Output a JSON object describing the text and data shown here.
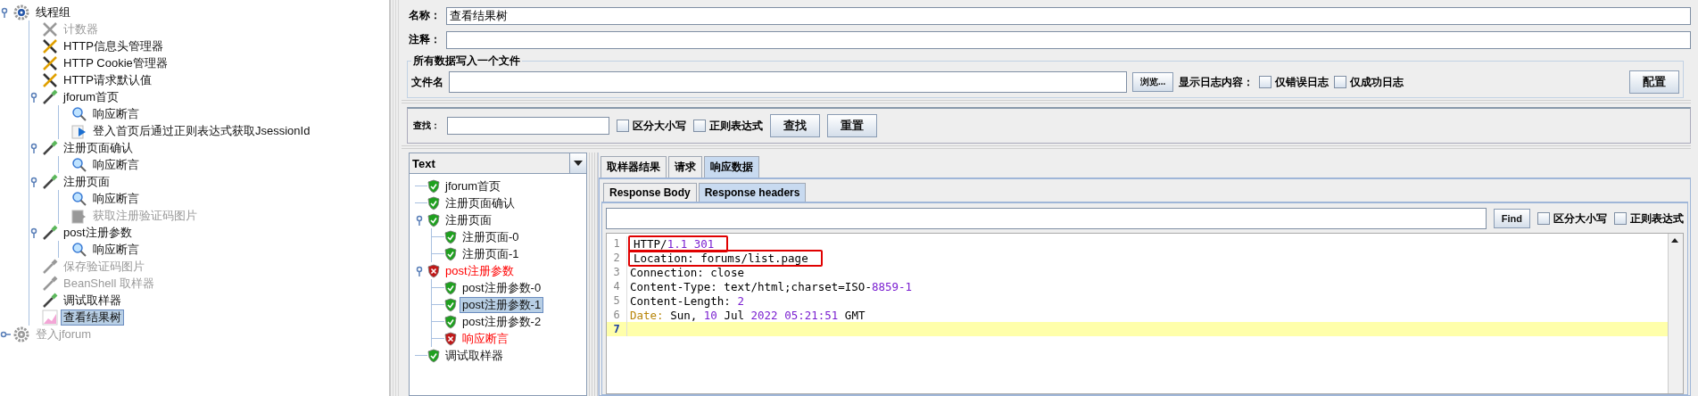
{
  "test_plan_tree": [
    {
      "label": "线程组",
      "kind": "thread_group",
      "disabled": false,
      "selected": false,
      "expanded": true,
      "children": [
        {
          "label": "计数器",
          "kind": "config",
          "disabled": true,
          "selected": false
        },
        {
          "label": "HTTP信息头管理器",
          "kind": "config",
          "disabled": false,
          "selected": false
        },
        {
          "label": "HTTP Cookie管理器",
          "kind": "config",
          "disabled": false,
          "selected": false
        },
        {
          "label": "HTTP请求默认值",
          "kind": "config",
          "disabled": false,
          "selected": false
        },
        {
          "label": "jforum首页",
          "kind": "sampler",
          "disabled": false,
          "selected": false,
          "expanded": true,
          "children": [
            {
              "label": "响应断言",
              "kind": "assertion",
              "disabled": false,
              "selected": false
            },
            {
              "label": "登入首页后通过正则表达式获取JsessionId",
              "kind": "extractor",
              "disabled": false,
              "selected": false
            }
          ]
        },
        {
          "label": "注册页面确认",
          "kind": "sampler",
          "disabled": false,
          "selected": false,
          "expanded": true,
          "children": [
            {
              "label": "响应断言",
              "kind": "assertion",
              "disabled": false,
              "selected": false
            }
          ]
        },
        {
          "label": "注册页面",
          "kind": "sampler",
          "disabled": false,
          "selected": false,
          "expanded": true,
          "children": [
            {
              "label": "响应断言",
              "kind": "assertion",
              "disabled": false,
              "selected": false
            },
            {
              "label": "获取注册验证码图片",
              "kind": "extractor",
              "disabled": true,
              "selected": false
            }
          ]
        },
        {
          "label": "post注册参数",
          "kind": "sampler",
          "disabled": false,
          "selected": false,
          "expanded": true,
          "children": [
            {
              "label": "响应断言",
              "kind": "assertion",
              "disabled": false,
              "selected": false
            }
          ]
        },
        {
          "label": "保存验证码图片",
          "kind": "sampler",
          "disabled": true,
          "selected": false
        },
        {
          "label": "BeanShell 取样器",
          "kind": "sampler",
          "disabled": true,
          "selected": false
        },
        {
          "label": "调试取样器",
          "kind": "sampler",
          "disabled": false,
          "selected": false
        },
        {
          "label": "查看结果树",
          "kind": "listener",
          "disabled": false,
          "selected": true
        }
      ]
    },
    {
      "label": "登入jforum",
      "kind": "thread_group",
      "disabled": true,
      "selected": false,
      "expanded": false
    }
  ],
  "form": {
    "name_label": "名称：",
    "name_value": "查看结果树",
    "comment_label": "注释：",
    "file_group": {
      "title": "所有数据写入一个文件",
      "file_label": "文件名",
      "browse_button": "浏览...",
      "log_label": "显示日志内容：",
      "checkboxes": [
        {
          "label": "仅错误日志",
          "checked": false
        },
        {
          "label": "仅成功日志",
          "checked": false
        }
      ],
      "config_button": "配置"
    }
  },
  "search_bar": {
    "label": "查找：",
    "checkboxes": [
      {
        "label": "区分大小写",
        "checked": false
      },
      {
        "label": "正则表达式",
        "checked": false
      }
    ],
    "find_button": "查找",
    "reset_button": "重置"
  },
  "renderer": {
    "value": "Text"
  },
  "results": [
    {
      "label": "jforum首页",
      "passed": true,
      "selected": false
    },
    {
      "label": "注册页面确认",
      "passed": true,
      "selected": false
    },
    {
      "label": "注册页面",
      "passed": true,
      "selected": false,
      "expanded": true,
      "children": [
        {
          "label": "注册页面-0",
          "passed": true,
          "selected": false
        },
        {
          "label": "注册页面-1",
          "passed": true,
          "selected": false
        }
      ]
    },
    {
      "label": "post注册参数",
      "passed": false,
      "selected": false,
      "expanded": true,
      "children": [
        {
          "label": "post注册参数-0",
          "passed": true,
          "selected": false
        },
        {
          "label": "post注册参数-1",
          "passed": true,
          "selected": true
        },
        {
          "label": "post注册参数-2",
          "passed": true,
          "selected": false
        },
        {
          "label": "响应断言",
          "passed": false,
          "selected": false
        }
      ]
    },
    {
      "label": "调试取样器",
      "passed": true,
      "selected": false
    }
  ],
  "tabs": [
    {
      "label": "取样器结果",
      "selected": false
    },
    {
      "label": "请求",
      "selected": false
    },
    {
      "label": "响应数据",
      "selected": true
    }
  ],
  "subtabs": [
    {
      "label": "Response Body",
      "selected": false
    },
    {
      "label": "Response headers",
      "selected": true
    }
  ],
  "find_bar": {
    "button": "Find",
    "checkboxes": [
      {
        "label": "区分大小写",
        "checked": false
      },
      {
        "label": "正则表达式",
        "checked": false
      }
    ]
  },
  "code_lines": [
    {
      "number": "1",
      "boxed": true,
      "current": false,
      "tokens": [
        {
          "text": "HTTP/",
          "kind": "plain"
        },
        {
          "text": "1.1 301",
          "kind": "number"
        }
      ]
    },
    {
      "number": "2",
      "boxed": true,
      "current": false,
      "tokens": [
        {
          "text": "Location: forums/list.page",
          "kind": "plain"
        }
      ]
    },
    {
      "number": "3",
      "boxed": false,
      "current": false,
      "tokens": [
        {
          "text": "Connection: close",
          "kind": "plain"
        }
      ]
    },
    {
      "number": "4",
      "boxed": false,
      "current": false,
      "tokens": [
        {
          "text": "Content-Type: text/html;charset=ISO-",
          "kind": "plain"
        },
        {
          "text": "8859-1",
          "kind": "number"
        }
      ]
    },
    {
      "number": "5",
      "boxed": false,
      "current": false,
      "tokens": [
        {
          "text": "Content-Length: ",
          "kind": "plain"
        },
        {
          "text": "2",
          "kind": "number"
        }
      ]
    },
    {
      "number": "6",
      "boxed": false,
      "current": false,
      "tokens": [
        {
          "text": "Date:",
          "kind": "key"
        },
        {
          "text": " Sun, ",
          "kind": "plain"
        },
        {
          "text": "10",
          "kind": "number"
        },
        {
          "text": " Jul ",
          "kind": "plain"
        },
        {
          "text": "2022 05:21:51",
          "kind": "number"
        },
        {
          "text": " GMT",
          "kind": "plain"
        }
      ]
    },
    {
      "number": "7",
      "boxed": false,
      "current": true
    }
  ]
}
